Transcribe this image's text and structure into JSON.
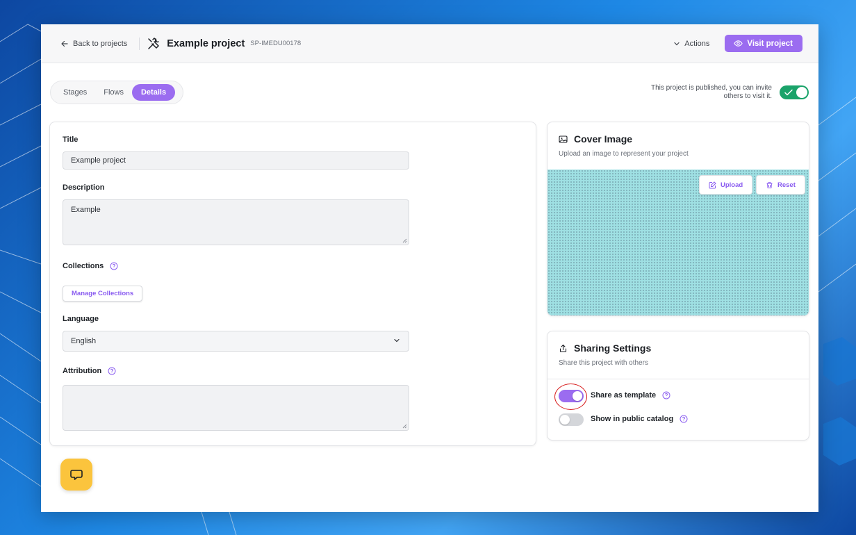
{
  "topbar": {
    "back_label": "Back to projects",
    "project_title": "Example project",
    "project_code": "SP-IMEDU00178",
    "actions_label": "Actions",
    "visit_label": "Visit project"
  },
  "tabs": [
    {
      "label": "Stages",
      "active": false
    },
    {
      "label": "Flows",
      "active": false
    },
    {
      "label": "Details",
      "active": true
    }
  ],
  "publish": {
    "note": "This project is published, you can invite others to visit it.",
    "enabled": true
  },
  "details": {
    "title_label": "Title",
    "title_value": "Example project",
    "description_label": "Description",
    "description_value": "Example",
    "collections_label": "Collections",
    "manage_collections_label": "Manage Collections",
    "language_label": "Language",
    "language_value": "English",
    "attribution_label": "Attribution",
    "attribution_value": ""
  },
  "cover": {
    "title": "Cover Image",
    "subtitle": "Upload an image to represent your project",
    "upload_label": "Upload",
    "reset_label": "Reset"
  },
  "sharing": {
    "title": "Sharing Settings",
    "subtitle": "Share this project with others",
    "share_template_label": "Share as template",
    "share_template_on": true,
    "public_catalog_label": "Show in public catalog",
    "public_catalog_on": false
  },
  "colors": {
    "accent": "#9b6cf0",
    "publish_green": "#1aa36a",
    "chat_yellow": "#fbc43d",
    "highlight_red": "#d81e1e"
  }
}
